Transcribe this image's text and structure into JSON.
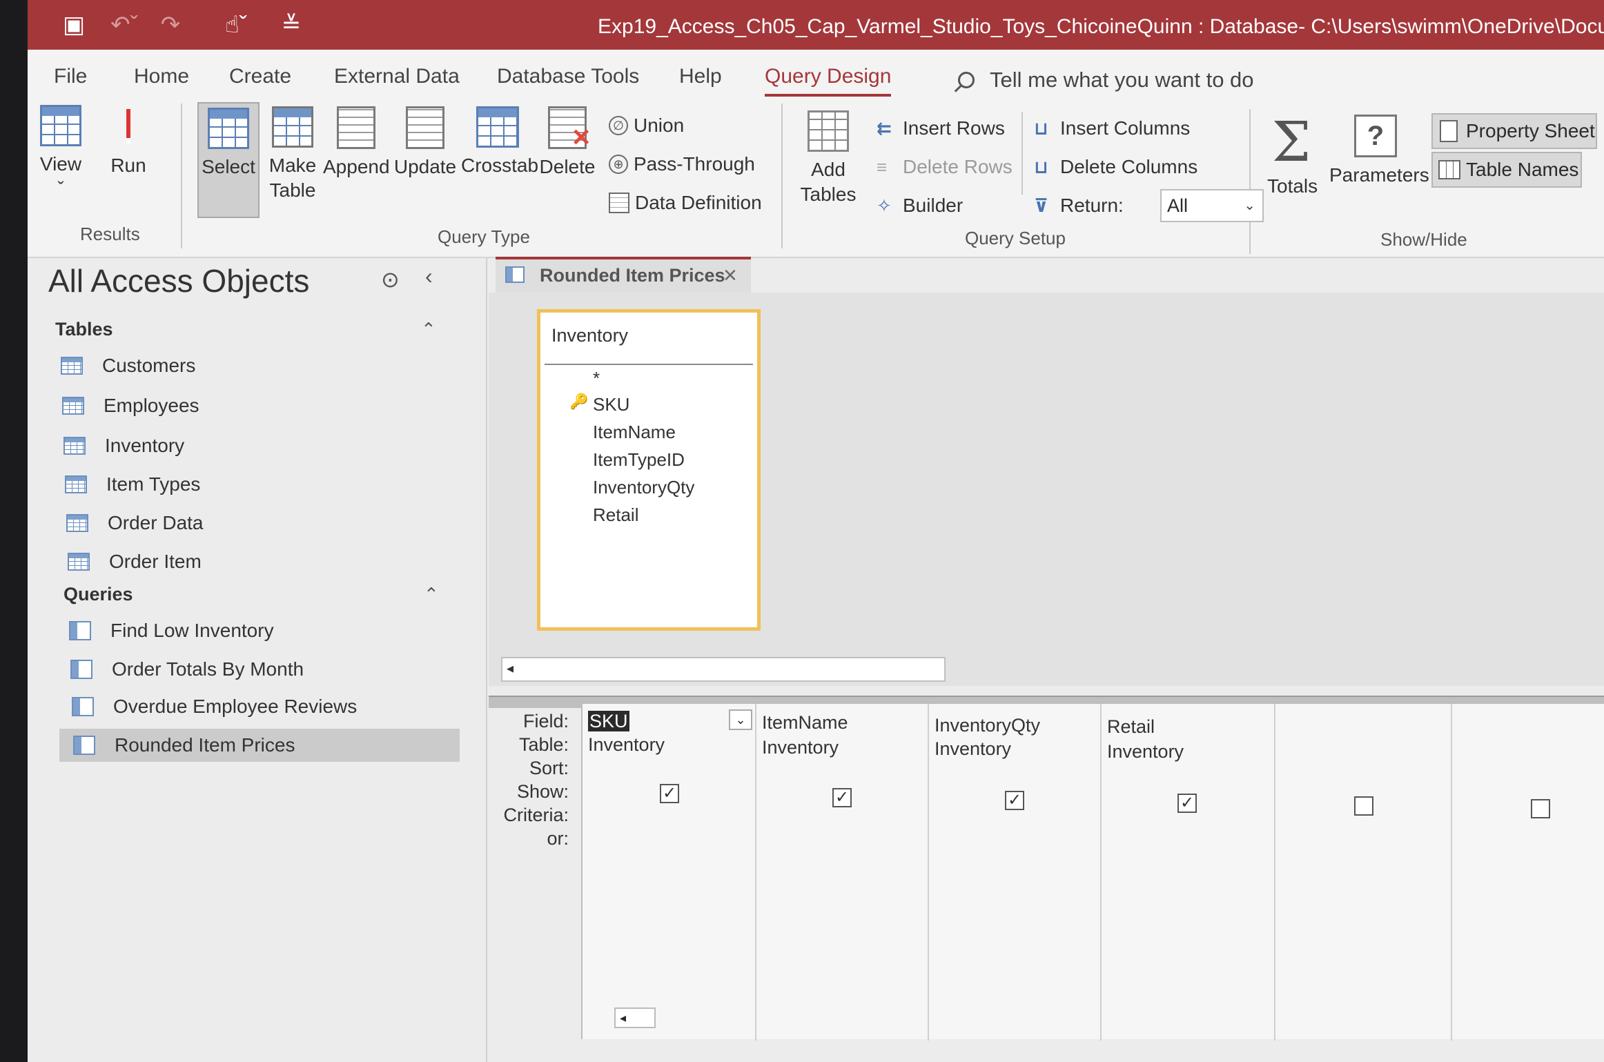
{
  "window": {
    "title": "Exp19_Access_Ch05_Cap_Varmel_Studio_Toys_ChicoineQuinn : Database- C:\\Users\\swimm\\OneDrive\\Documents\\Exp19_A",
    "accent": "#a4373a"
  },
  "tabs": [
    {
      "label": "File"
    },
    {
      "label": "Home"
    },
    {
      "label": "Create"
    },
    {
      "label": "External Data"
    },
    {
      "label": "Database Tools"
    },
    {
      "label": "Help"
    },
    {
      "label": "Query Design"
    }
  ],
  "tell_me": "Tell me what you want to do",
  "ribbon": {
    "results": {
      "label": "Results",
      "view": "View",
      "run": "Run"
    },
    "query_type": {
      "label": "Query Type",
      "select": "Select",
      "make_table_1": "Make",
      "make_table_2": "Table",
      "append": "Append",
      "update": "Update",
      "crosstab": "Crosstab",
      "delete": "Delete",
      "union": "Union",
      "pass_through": "Pass-Through",
      "data_definition": "Data Definition"
    },
    "query_setup": {
      "label": "Query Setup",
      "add_tables_1": "Add",
      "add_tables_2": "Tables",
      "insert_rows": "Insert Rows",
      "delete_rows": "Delete Rows",
      "builder": "Builder",
      "insert_columns": "Insert Columns",
      "delete_columns": "Delete Columns",
      "return_label": "Return:",
      "return_value": "All"
    },
    "show_hide": {
      "label": "Show/Hide",
      "totals": "Totals",
      "parameters": "Parameters",
      "property_sheet": "Property Sheet",
      "table_names": "Table Names"
    }
  },
  "nav": {
    "title": "All Access Objects",
    "tables_header": "Tables",
    "tables": [
      "Customers",
      "Employees",
      "Inventory",
      "Item Types",
      "Order Data",
      "Order Item"
    ],
    "queries_header": "Queries",
    "queries": [
      "Find Low Inventory",
      "Order Totals By Month",
      "Overdue Employee Reviews",
      "Rounded Item Prices"
    ]
  },
  "doc_tab": "Rounded Item Prices",
  "field_list": {
    "table": "Inventory",
    "star": "*",
    "fields": [
      "SKU",
      "ItemName",
      "ItemTypeID",
      "InventoryQty",
      "Retail"
    ]
  },
  "grid": {
    "row_labels": [
      "Field:",
      "Table:",
      "Sort:",
      "Show:",
      "Criteria:",
      "or:"
    ],
    "columns": [
      {
        "field": "SKU",
        "table": "Inventory",
        "show": true
      },
      {
        "field": "ItemName",
        "table": "Inventory",
        "show": true
      },
      {
        "field": "InventoryQty",
        "table": "Inventory",
        "show": true
      },
      {
        "field": "Retail",
        "table": "Inventory",
        "show": true
      },
      {
        "field": "",
        "table": "",
        "show": false
      },
      {
        "field": "",
        "table": "",
        "show": false
      }
    ]
  }
}
